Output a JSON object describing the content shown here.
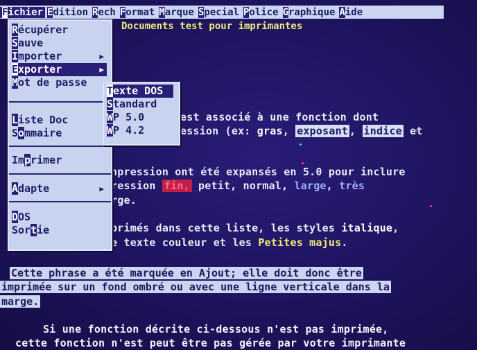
{
  "menubar": {
    "items": [
      {
        "hot": "F",
        "rest": "ichier"
      },
      {
        "hot": "E",
        "rest": "dition"
      },
      {
        "hot": "R",
        "rest": "ech"
      },
      {
        "hot": "F",
        "rest": "ormat"
      },
      {
        "hot": "M",
        "rest": "arque"
      },
      {
        "hot": "S",
        "rest": "pecial"
      },
      {
        "hot": "P",
        "rest": "olice"
      },
      {
        "hot": "G",
        "rest": "raphique"
      },
      {
        "hot": "A",
        "rest": "ide"
      }
    ]
  },
  "file_menu": {
    "items": [
      {
        "pre": "",
        "hot": "R",
        "rest": "écupérer"
      },
      {
        "pre": "",
        "hot": "S",
        "rest": "auve"
      },
      {
        "pre": "",
        "hot": "I",
        "rest": "mporter"
      },
      {
        "pre": "",
        "hot": "E",
        "rest": "xporter"
      },
      {
        "pre": "",
        "hot": "M",
        "rest": "ot de passe"
      },
      {
        "pre": "",
        "hot": "L",
        "rest": "iste Doc"
      },
      {
        "pre": "S",
        "hot": "o",
        "rest": "mmaire"
      },
      {
        "pre": "Im",
        "hot": "p",
        "rest": "rimer"
      },
      {
        "pre": "",
        "hot": "A",
        "rest": "dapte"
      },
      {
        "pre": "",
        "hot": "D",
        "rest": "OS"
      },
      {
        "pre": "Sor",
        "hot": "t",
        "rest": "ie"
      }
    ]
  },
  "export_submenu": {
    "items": [
      {
        "hot": "T",
        "rest": "exte DOS"
      },
      {
        "hot": "S",
        "rest": "tandard"
      },
      {
        "hot": "W",
        "rest": "P 5.0"
      },
      {
        "hot": "W",
        "rest": "P 4.2"
      }
    ]
  },
  "document": {
    "title": "Documents test pour imprimantes",
    "line1": "est associé à une fonction dont",
    "line2_a": "ession (ex: ",
    "line2_gras": "gras",
    "line2_sep": ", ",
    "line2_exposant": "exposant",
    "line2_sep2": ", ",
    "line2_indice": "indice",
    "line2_end": " et",
    "line3": "npression ont été expansés en 5.0 pour inclure",
    "line4_a": "ression ",
    "line4_fin": "fin,",
    "line4_b": " petit, normal, ",
    "line4_large": "large",
    "line4_c": ", ",
    "line4_tres": "très",
    "line5": "rge.",
    "line6_a": "primés dans cette liste, les styles ",
    "line6_italique": "italique",
    "line6_end": ",",
    "line7_a": "e texte couleur et les ",
    "line7_petites": "Petites majus",
    "line7_end": ".",
    "marked1": "Cette phrase a été marquée en Ajout; elle doit donc être",
    "marked2": "imprimée sur un fond ombré ou avec une ligne verticale dans la",
    "marked3": "marge.",
    "footer1": "Si une fonction décrite ci-dessous n'est pas imprimée,",
    "footer2": "cette fonction n'est peut être pas gérée par votre imprimante"
  }
}
